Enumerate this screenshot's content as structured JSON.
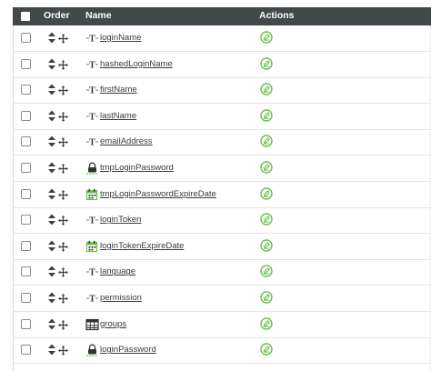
{
  "header": {
    "order": "Order",
    "name": "Name",
    "actions": "Actions"
  },
  "colors": {
    "header_bg": "#43484b",
    "accent_green": "#6cc04a",
    "text": "#3b3b3b"
  },
  "rows": [
    {
      "name": "loginName",
      "type_icon": "text-type-icon"
    },
    {
      "name": "hashedLoginName",
      "type_icon": "text-type-icon"
    },
    {
      "name": "firstName",
      "type_icon": "text-type-icon"
    },
    {
      "name": "lastName",
      "type_icon": "text-type-icon"
    },
    {
      "name": "emailAddress",
      "type_icon": "text-type-icon"
    },
    {
      "name": "tmpLoginPassword",
      "type_icon": "password-lock-icon"
    },
    {
      "name": "tmpLoginPasswordExpireDate",
      "type_icon": "calendar-icon"
    },
    {
      "name": "loginToken",
      "type_icon": "text-type-icon"
    },
    {
      "name": "loginTokenExpireDate",
      "type_icon": "calendar-icon"
    },
    {
      "name": "language",
      "type_icon": "text-type-icon"
    },
    {
      "name": "permission",
      "type_icon": "text-type-icon"
    },
    {
      "name": "groups",
      "type_icon": "table-icon"
    },
    {
      "name": "loginPassword",
      "type_icon": "password-lock-icon"
    }
  ]
}
